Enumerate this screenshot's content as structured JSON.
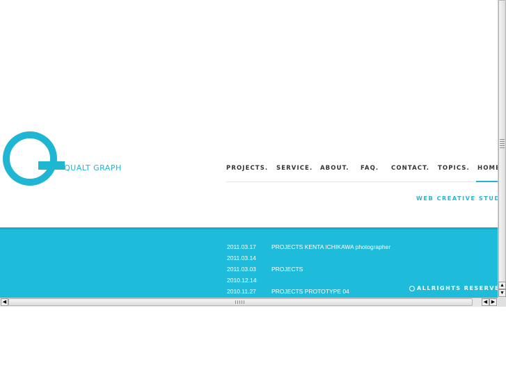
{
  "brand": {
    "name": "QUALT GRAPH",
    "color": "#1fb6d3"
  },
  "nav": {
    "items": [
      {
        "label": "PROJECTS."
      },
      {
        "label": "SERVICE."
      },
      {
        "label": "ABOUT."
      },
      {
        "label": "FAQ."
      },
      {
        "label": "CONTACT."
      },
      {
        "label": "TOPICS."
      },
      {
        "label": "HOME.",
        "active": true
      }
    ]
  },
  "tagline": "WEB CREATIVE STUDIO",
  "news": [
    {
      "date": "2011.03.17",
      "title": "PROJECTS KENTA ICHIKAWA photographer"
    },
    {
      "date": "2011.03.14",
      "title": ""
    },
    {
      "date": "2011.03.03",
      "title": "PROJECTS"
    },
    {
      "date": "2010.12.14",
      "title": ""
    },
    {
      "date": "2010.11.27",
      "title": "PROJECTS PROTOTYPE 04"
    }
  ],
  "footer": {
    "copyright": "ALLRIGHTS RESERVED"
  },
  "scrollbar": {
    "up_arrow": "▲",
    "down_arrow": "▼",
    "left_arrow": "◀",
    "right_arrow": "▶",
    "icons": [
      "scroll-up-icon",
      "scroll-down-icon",
      "scroll-left-icon",
      "scroll-right-icon"
    ]
  },
  "colors": {
    "band": "#1fbbdb",
    "text": "#333333",
    "accent": "#1fb6d3"
  }
}
